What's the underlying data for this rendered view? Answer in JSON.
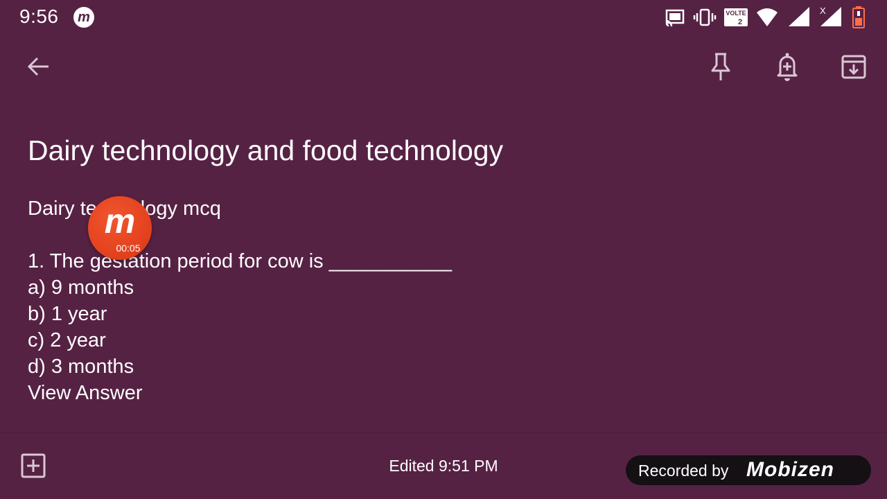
{
  "status_bar": {
    "time": "9:56",
    "app_badge": "m",
    "network_label": "VOLTE",
    "sim_label": "2",
    "signal_extra": "X",
    "icons": [
      "cast-icon",
      "vibrate-icon",
      "volte-icon",
      "wifi-icon",
      "signal-icon",
      "signal-no-data-icon",
      "battery-low-icon"
    ]
  },
  "toolbar": {
    "icons": [
      "back-arrow-icon",
      "pin-icon",
      "reminder-bell-icon",
      "archive-icon"
    ]
  },
  "note": {
    "title": "Dairy technology and food technology",
    "body": {
      "subtitle": "Dairy technology mcq",
      "question": "1. The gestation period for cow is ___________",
      "options": [
        "a) 9 months",
        "b) 1 year",
        "c) 2 year",
        "d) 3 months"
      ],
      "link": "View Answer"
    }
  },
  "recording_bubble": {
    "letter": "m",
    "timer": "00:05"
  },
  "bottom_bar": {
    "edited": "Edited 9:51 PM",
    "recorded_by": "Recorded by",
    "brand": "Mobizen"
  },
  "colors": {
    "background": "#562244",
    "bubble": "#e2401c",
    "badge": "#141014",
    "icon": "#d9c8d3"
  }
}
